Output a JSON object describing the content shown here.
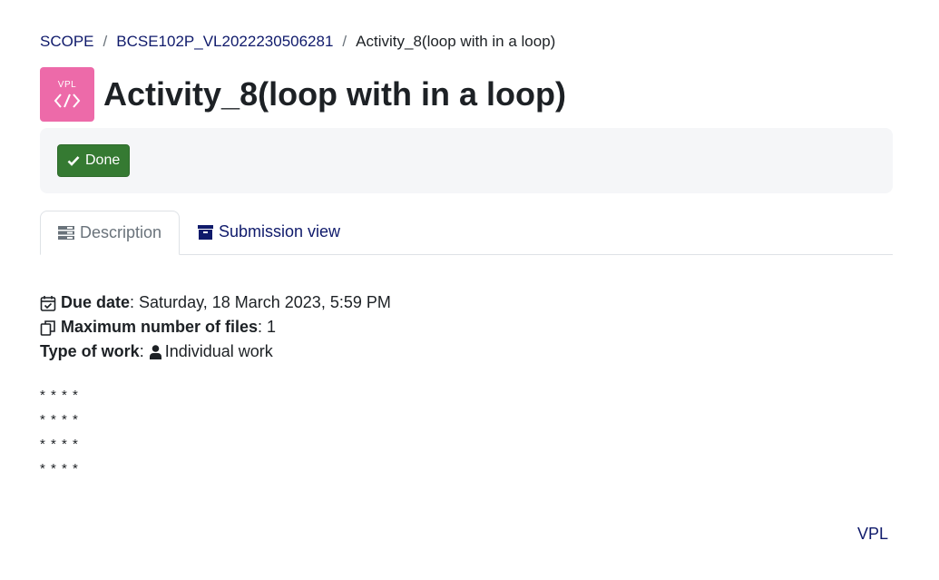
{
  "breadcrumb": {
    "items": [
      "SCOPE",
      "BCSE102P_VL2022230506281"
    ],
    "current": "Activity_8(loop with in a loop)",
    "separator": "/"
  },
  "header": {
    "icon_label": "VPL",
    "title": "Activity_8(loop with in a loop)"
  },
  "completion": {
    "done_label": "Done",
    "done_color": "#357a32"
  },
  "tabs": [
    {
      "label": "Description",
      "icon": "list-icon",
      "active": true
    },
    {
      "label": "Submission view",
      "icon": "archive-icon",
      "active": false
    }
  ],
  "details": {
    "due_label": "Due date",
    "due_value": ": Saturday, 18 March 2023, 5:59 PM",
    "maxfiles_label": "Maximum number of files",
    "maxfiles_value": ": 1",
    "worktype_label": "Type of work",
    "worktype_sep": ":",
    "worktype_value": "Individual work"
  },
  "pattern_lines": [
    "* * * *",
    "* * * *",
    "* * * *",
    "* * * *"
  ],
  "footer": {
    "link_label": "VPL"
  },
  "colors": {
    "accent": "#0f1a6b",
    "icon_bg": "#ed6aa9"
  }
}
